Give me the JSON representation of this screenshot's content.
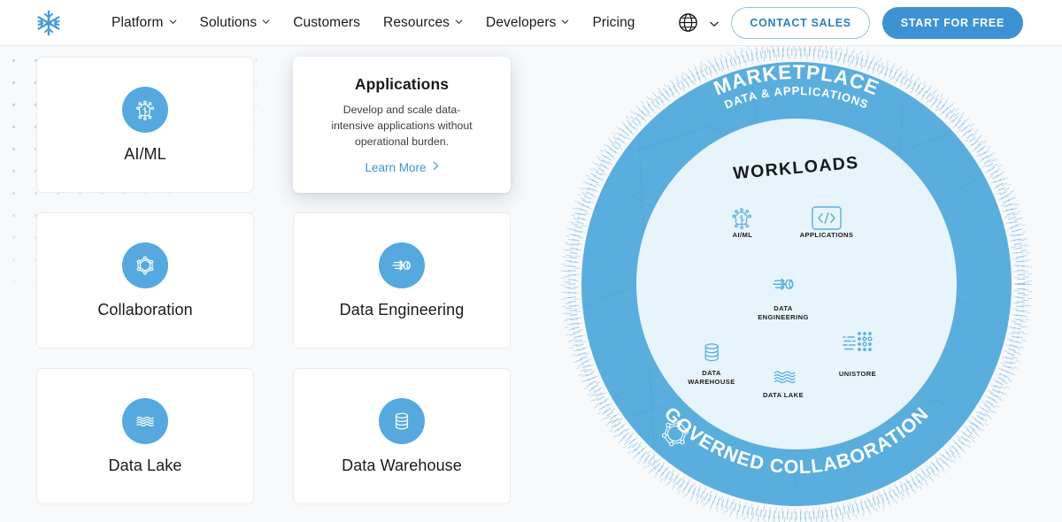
{
  "header": {
    "logo_icon": "snowflake-logo-icon",
    "nav": [
      {
        "label": "Platform",
        "has_dropdown": true
      },
      {
        "label": "Solutions",
        "has_dropdown": true
      },
      {
        "label": "Customers",
        "has_dropdown": false
      },
      {
        "label": "Resources",
        "has_dropdown": true
      },
      {
        "label": "Developers",
        "has_dropdown": true
      },
      {
        "label": "Pricing",
        "has_dropdown": false
      }
    ],
    "language_icon": "globe-icon",
    "language_chevron_icon": "chevron-down-icon",
    "contact_sales_label": "CONTACT SALES",
    "start_free_label": "START FOR FREE"
  },
  "cards": [
    {
      "title": "AI/ML",
      "icon": "brain-circuit-icon",
      "active": false,
      "description": "",
      "link_label": ""
    },
    {
      "title": "Applications",
      "icon": "code-brackets-icon",
      "active": true,
      "description": "Develop and scale data-intensive applications without operational burden.",
      "link_label": "Learn More"
    },
    {
      "title": "Collaboration",
      "icon": "hexagon-network-icon",
      "active": false,
      "description": "",
      "link_label": ""
    },
    {
      "title": "Data Engineering",
      "icon": "data-pipeline-icon",
      "active": false,
      "description": "",
      "link_label": ""
    },
    {
      "title": "Data Lake",
      "icon": "waves-icon",
      "active": false,
      "description": "",
      "link_label": ""
    },
    {
      "title": "Data Warehouse",
      "icon": "database-cylinder-icon",
      "active": false,
      "description": "",
      "link_label": ""
    }
  ],
  "diagram": {
    "outer_ring_top_primary": "MARKETPLACE",
    "outer_ring_top_secondary": "DATA & APPLICATIONS",
    "outer_ring_bottom": "GOVERNED COLLABORATION",
    "outer_ring_bottom_icon": "hexagon-network-icon",
    "inner_title": "WORKLOADS",
    "workloads": [
      {
        "label_line1": "AI/ML",
        "label_line2": "",
        "icon": "brain-circuit-icon"
      },
      {
        "label_line1": "APPLICATIONS",
        "label_line2": "",
        "icon": "code-brackets-icon"
      },
      {
        "label_line1": "DATA",
        "label_line2": "ENGINEERING",
        "icon": "data-pipeline-icon"
      },
      {
        "label_line1": "DATA",
        "label_line2": "WAREHOUSE",
        "icon": "database-cylinder-icon"
      },
      {
        "label_line1": "DATA LAKE",
        "label_line2": "",
        "icon": "waves-icon"
      },
      {
        "label_line1": "UNISTORE",
        "label_line2": "",
        "icon": "unistore-dots-icon"
      }
    ]
  },
  "colors": {
    "brand_blue": "#3d92d3",
    "icon_circle_blue": "#56a9df",
    "ring_blue": "#5aaedd",
    "inner_circle": "#e8f4fb",
    "page_background": "#f7f9fb",
    "link_blue": "#3d92d3"
  }
}
